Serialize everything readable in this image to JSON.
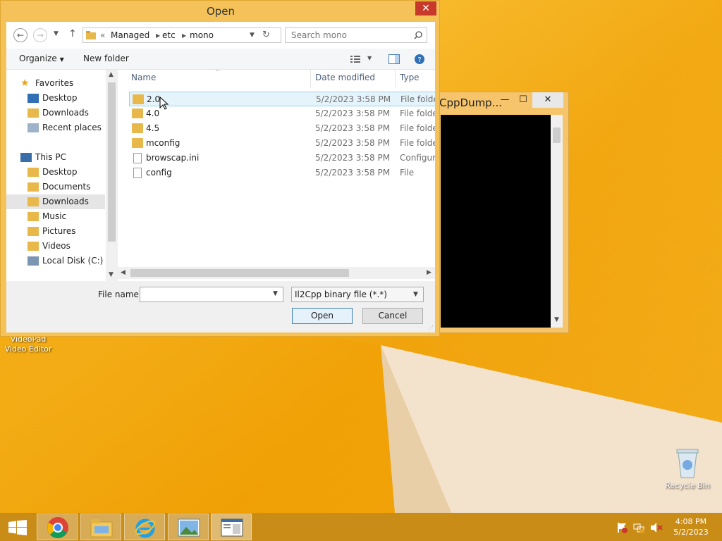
{
  "dialog": {
    "title": "Open",
    "close_label": "✕",
    "address": {
      "overflow": "«",
      "crumbs": [
        "Managed",
        "etc",
        "mono"
      ]
    },
    "search_placeholder": "Search mono",
    "toolbar": {
      "organize_label": "Organize",
      "new_folder_label": "New folder"
    },
    "nav": {
      "favorites_label": "Favorites",
      "fav_items": [
        "Desktop",
        "Downloads",
        "Recent places"
      ],
      "this_pc_label": "This PC",
      "pc_items": [
        "Desktop",
        "Documents",
        "Downloads",
        "Music",
        "Pictures",
        "Videos",
        "Local Disk (C:)"
      ],
      "selected": "Downloads"
    },
    "columns": {
      "name": "Name",
      "date": "Date modified",
      "type": "Type"
    },
    "files": [
      {
        "name": "2.0",
        "date": "5/2/2023 3:58 PM",
        "type": "File folder",
        "icon": "folder-icon"
      },
      {
        "name": "4.0",
        "date": "5/2/2023 3:58 PM",
        "type": "File folder",
        "icon": "folder-icon"
      },
      {
        "name": "4.5",
        "date": "5/2/2023 3:58 PM",
        "type": "File folder",
        "icon": "folder-icon"
      },
      {
        "name": "mconfig",
        "date": "5/2/2023 3:58 PM",
        "type": "File folder",
        "icon": "folder-icon"
      },
      {
        "name": "browscap.ini",
        "date": "5/2/2023 3:58 PM",
        "type": "Configura",
        "icon": "file-icon"
      },
      {
        "name": "config",
        "date": "5/2/2023 3:58 PM",
        "type": "File",
        "icon": "file-icon"
      }
    ],
    "file_name_label": "File name:",
    "file_name_value": "",
    "filter_value": "Il2Cpp binary file (*.*)",
    "open_label": "Open",
    "cancel_label": "Cancel"
  },
  "console": {
    "title": "CppDump...",
    "min_label": "—",
    "max_label": "☐",
    "close_label": "✕"
  },
  "desktop": {
    "videopad_label": "VideoPad\nVideo Editor",
    "videopad_line1": "VideoPad",
    "videopad_line2": "Video Editor",
    "recycle_label": "Recycle Bin"
  },
  "taskbar": {
    "time": "4:08 PM",
    "date": "5/2/2023",
    "apps": [
      "start-icon",
      "chrome-icon",
      "file-explorer-icon",
      "internet-explorer-icon",
      "photo-icon",
      "app-window-icon"
    ]
  },
  "colors": {
    "accent": "#f4c258",
    "close": "#c7392b",
    "selection": "#e5f3fb"
  }
}
